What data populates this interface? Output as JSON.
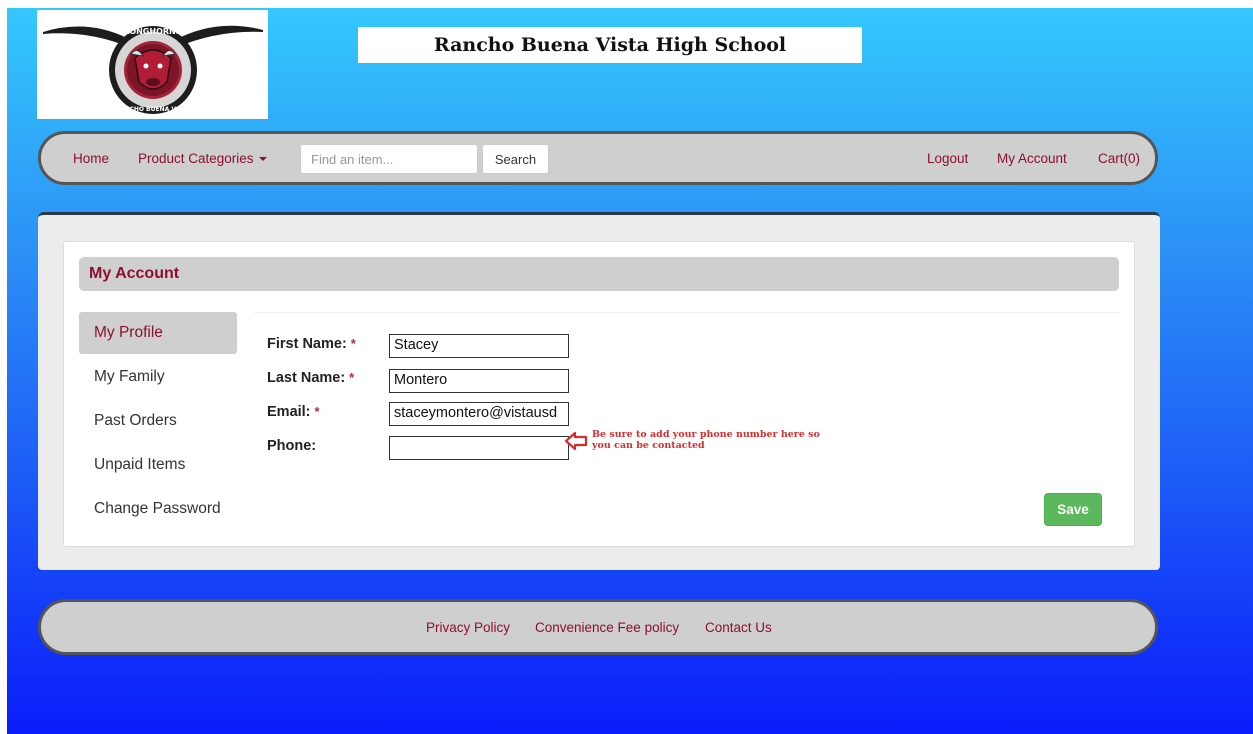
{
  "header": {
    "logo_top_text": "LONGHORNS",
    "logo_bottom_text": "RANCHO BUENA VISTA",
    "school_name": "Rancho Buena Vista High School"
  },
  "navbar": {
    "home": "Home",
    "product_categories": "Product Categories",
    "search_placeholder": "Find an item...",
    "search_button": "Search",
    "logout": "Logout",
    "my_account": "My Account",
    "cart": "Cart(0)"
  },
  "account": {
    "heading": "My Account",
    "sidebar": [
      {
        "label": "My Profile",
        "active": true
      },
      {
        "label": "My Family",
        "active": false
      },
      {
        "label": "Past Orders",
        "active": false
      },
      {
        "label": "Unpaid Items",
        "active": false
      },
      {
        "label": "Change Password",
        "active": false
      }
    ],
    "required_marker": "*",
    "fields": {
      "first_name": {
        "label": "First Name:",
        "value": "Stacey"
      },
      "last_name": {
        "label": "Last Name:",
        "value": "Montero"
      },
      "email": {
        "label": "Email:",
        "value": "staceymontero@vistausd"
      },
      "phone": {
        "label": "Phone:",
        "value": ""
      }
    },
    "phone_hint": "Be sure to add your phone number here so you can be contacted",
    "save_button": "Save"
  },
  "footer": {
    "privacy_policy": "Privacy Policy",
    "convenience_fee": "Convenience Fee policy",
    "contact_us": "Contact Us"
  },
  "colors": {
    "brand_maroon": "#8b1030",
    "save_green": "#5cb85c",
    "hint_red": "#d62d2d",
    "bg_top": "#34c8fc",
    "bg_bottom": "#0a1dfb"
  }
}
